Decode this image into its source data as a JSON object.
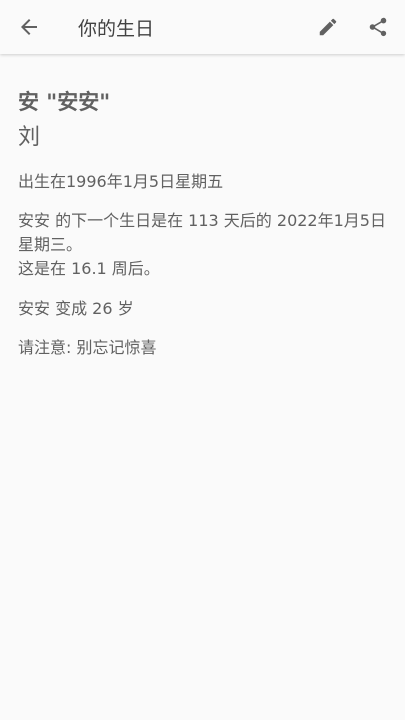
{
  "toolbar": {
    "title": "你的生日",
    "back_icon": "arrow-back-icon",
    "edit_icon": "pencil-icon",
    "share_icon": "share-icon"
  },
  "content": {
    "name_line": "安 \"安安\"",
    "surname": "刘",
    "born": "出生在1996年1月5日星期五",
    "next_birthday_line1": "安安 的下一个生日是在 113 天后的 2022年1月5日星期三。",
    "next_birthday_line2": "这是在 16.1 周后。",
    "age": "安安 变成 26 岁",
    "note": "请注意: 别忘记惊喜"
  },
  "colors": {
    "background": "#fafafa",
    "text": "#616161",
    "icon": "#616161"
  }
}
